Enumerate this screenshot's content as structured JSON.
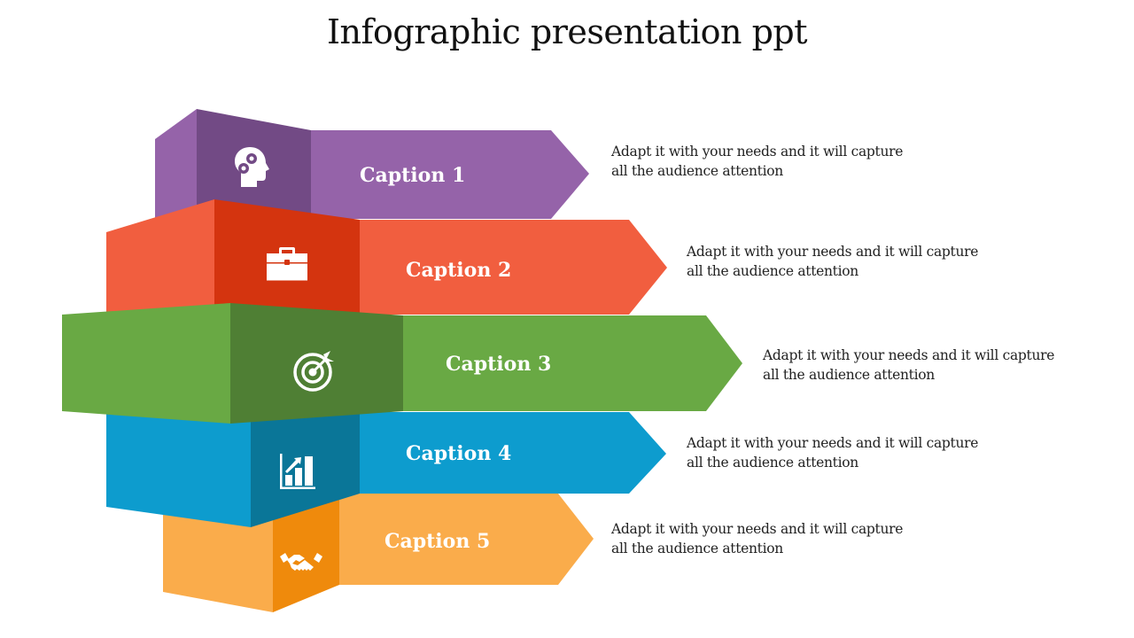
{
  "slide": {
    "title": "Infographic presentation ppt"
  },
  "steps": [
    {
      "caption": "Caption 1",
      "icon": "head-gears-icon",
      "description_line1": "Adapt it with your needs and it will capture",
      "description_line2": "all the audience attention",
      "colors": {
        "main": "#9563A9",
        "dark": "#724A85"
      }
    },
    {
      "caption": "Caption 2",
      "icon": "briefcase-icon",
      "description_line1": "Adapt it with your needs and it will capture",
      "description_line2": "all the audience attention",
      "colors": {
        "main": "#F15E3F",
        "dark": "#D4340F"
      }
    },
    {
      "caption": "Caption 3",
      "icon": "target-arrow-icon",
      "description_line1": "Adapt it with your needs and it will capture",
      "description_line2": "all the audience attention",
      "colors": {
        "main": "#69A944",
        "dark": "#4F7F34"
      }
    },
    {
      "caption": "Caption 4",
      "icon": "growth-chart-icon",
      "description_line1": "Adapt it with your needs and it will capture",
      "description_line2": "all the audience attention",
      "colors": {
        "main": "#0D9CCE",
        "dark": "#0A7698"
      }
    },
    {
      "caption": "Caption 5",
      "icon": "handshake-icon",
      "description_line1": "Adapt it with your needs and it will capture",
      "description_line2": "all the audience attention",
      "colors": {
        "main": "#FAAC4B",
        "dark": "#EF8A0C"
      }
    }
  ]
}
